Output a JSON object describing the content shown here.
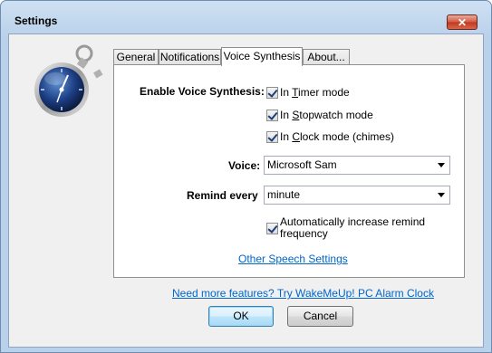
{
  "window": {
    "title": "Settings",
    "close_glyph": "✕"
  },
  "tabs": [
    {
      "label": "General"
    },
    {
      "label": "Notifications"
    },
    {
      "label": "Voice Synthesis",
      "active": true
    },
    {
      "label": "About..."
    }
  ],
  "voice": {
    "enable_label": "Enable Voice Synthesis:",
    "timer_label_pre": "In ",
    "timer_label_u": "T",
    "timer_label_post": "imer mode",
    "timer_checked": true,
    "stopwatch_label_pre": "In ",
    "stopwatch_label_u": "S",
    "stopwatch_label_post": "topwatch mode",
    "stopwatch_checked": true,
    "clock_label_pre": "In ",
    "clock_label_u": "C",
    "clock_label_post": "lock mode (chimes)",
    "clock_checked": true,
    "voice_label": "Voice:",
    "voice_value": "Microsoft Sam",
    "remind_label": "Remind every",
    "remind_value": "minute",
    "auto_increase_line1": "Automatically increase remind",
    "auto_increase_line2": "frequency",
    "auto_increase_checked": true,
    "other_speech_link": "Other Speech Settings"
  },
  "footer": {
    "promo_link": "Need more features? Try WakeMeUp! PC Alarm Clock",
    "ok_label": "OK",
    "cancel_label": "Cancel"
  },
  "colors": {
    "link": "#0066cc",
    "titlebar": "#b9d1ea",
    "close": "#c0381e"
  },
  "icons": {
    "app": "stopwatch-icon",
    "close": "close-icon",
    "dropdown": "chevron-down-icon"
  }
}
